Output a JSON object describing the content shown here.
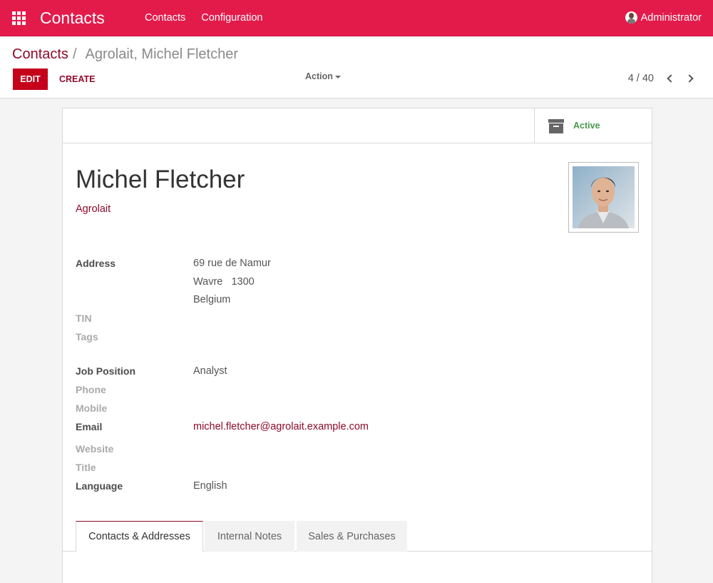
{
  "navbar": {
    "brand": "Contacts",
    "menu": [
      "Contacts",
      "Configuration"
    ],
    "user": "Administrator"
  },
  "control": {
    "breadcrumb_parent": "Contacts",
    "breadcrumb_separator": "/",
    "breadcrumb_current": "Agrolait, Michel Fletcher",
    "edit_label": "EDIT",
    "create_label": "CREATE",
    "action_label": "Action",
    "pager": "4 / 40"
  },
  "sheet": {
    "status_label": "Active",
    "name": "Michel Fletcher",
    "company": "Agrolait",
    "fields": {
      "address_label": "Address",
      "address_line1": "69 rue de Namur",
      "address_line2": "Wavre   1300",
      "address_line3": "Belgium",
      "tin_label": "TIN",
      "tags_label": "Tags",
      "job_label": "Job Position",
      "job_value": "Analyst",
      "phone_label": "Phone",
      "mobile_label": "Mobile",
      "email_label": "Email",
      "email_value": "michel.fletcher@agrolait.example.com",
      "website_label": "Website",
      "title_label": "Title",
      "language_label": "Language",
      "language_value": "English"
    },
    "tabs": [
      "Contacts & Addresses",
      "Internal Notes",
      "Sales & Purchases"
    ]
  },
  "colors": {
    "navbar": "#e31b4b",
    "primary": "#c5001a",
    "link": "#8f0a2a",
    "active_status": "#4a9a4a"
  }
}
